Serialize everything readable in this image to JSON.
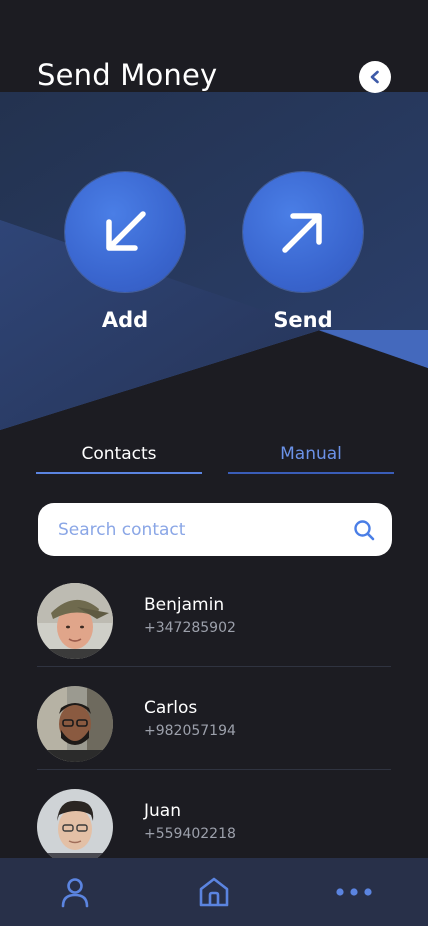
{
  "header": {
    "title": "Send Money"
  },
  "actions": {
    "add_label": "Add",
    "send_label": "Send"
  },
  "tabs": [
    {
      "label": "Contacts",
      "active": true
    },
    {
      "label": "Manual",
      "active": false
    }
  ],
  "search": {
    "placeholder": "Search contact",
    "value": ""
  },
  "contacts": [
    {
      "name": "Benjamin",
      "phone": "+347285902"
    },
    {
      "name": "Carlos",
      "phone": "+982057194"
    },
    {
      "name": "Juan",
      "phone": "+559402218"
    }
  ],
  "colors": {
    "background": "#1c1c22",
    "accent": "#3a66cf",
    "accent_light": "#6b92e8",
    "nav_bar": "#283049"
  },
  "icons": {
    "back": "chevron-left-icon",
    "add": "arrow-down-left-icon",
    "send": "arrow-up-right-icon",
    "search": "search-icon",
    "nav_profile": "user-icon",
    "nav_home": "home-icon",
    "nav_more": "more-icon"
  }
}
